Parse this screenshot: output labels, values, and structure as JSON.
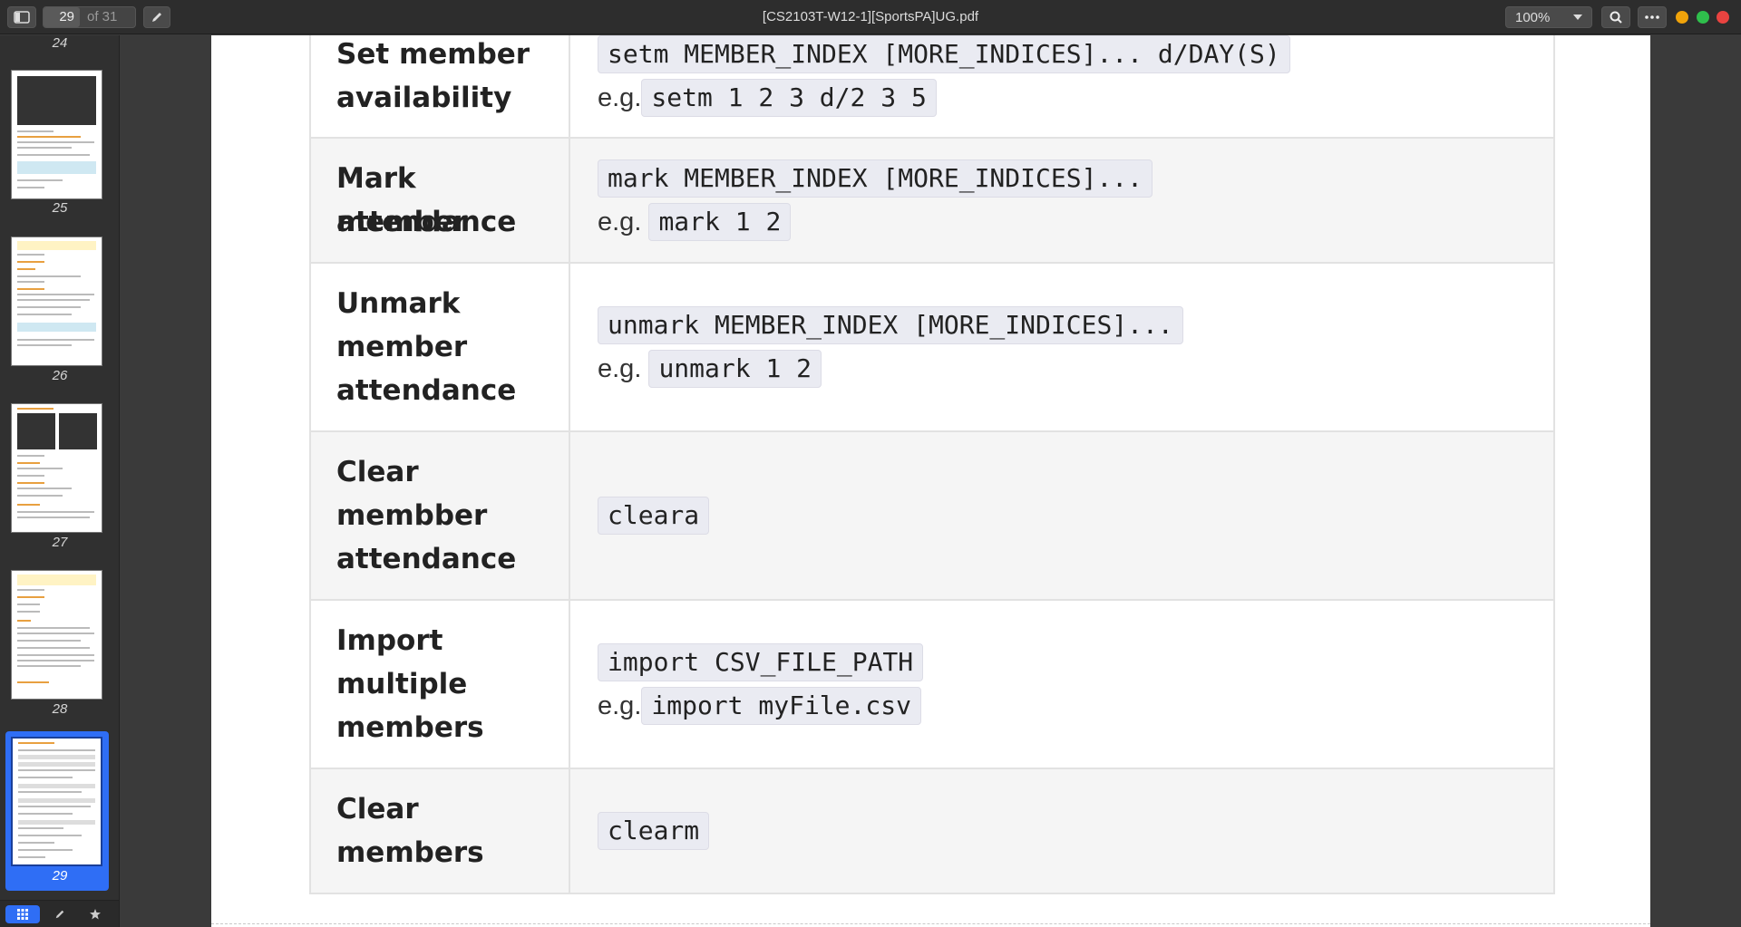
{
  "titlebar": {
    "title": "[CS2103T-W12-1][SportsPA]UG.pdf",
    "page_current": "29",
    "page_total": "of 31",
    "zoom": "100%"
  },
  "sidebar": {
    "top_label": "24",
    "thumbnails": [
      {
        "label": "25"
      },
      {
        "label": "26"
      },
      {
        "label": "27"
      },
      {
        "label": "28"
      },
      {
        "label": "29",
        "selected": true
      }
    ]
  },
  "table": {
    "rows": [
      {
        "action": [
          "Set member",
          "availability"
        ],
        "format": "setm MEMBER_INDEX [MORE_INDICES]... d/DAY(S)",
        "eg_prefix": "e.g.",
        "example": "setm 1 2 3 d/2 3 5"
      },
      {
        "action": [
          "Mark member",
          "attendance"
        ],
        "format": "mark MEMBER_INDEX [MORE_INDICES]...",
        "eg_prefix": "e.g.",
        "example": "mark 1 2"
      },
      {
        "action": [
          "Unmark",
          "member",
          "attendance"
        ],
        "format": "unmark MEMBER_INDEX [MORE_INDICES]...",
        "eg_prefix": "e.g.",
        "example": "unmark 1 2"
      },
      {
        "action": [
          "Clear",
          "membber",
          "attendance"
        ],
        "format": "cleara"
      },
      {
        "action": [
          "Import",
          "multiple",
          "members"
        ],
        "format": "import CSV_FILE_PATH",
        "eg_prefix": "e.g.",
        "example": "import myFile.csv"
      },
      {
        "action": [
          "Clear",
          "members"
        ],
        "format": "clearm"
      }
    ]
  },
  "icons": {
    "sidebar_toggle": "sidebar-toggle-icon",
    "annotate": "pencil-icon",
    "zoom_dropdown": "chevron-down-icon",
    "search": "search-icon",
    "more": "more-icon",
    "grid": "grid-icon",
    "annotations": "pencil-icon",
    "bookmarks": "star-icon"
  },
  "colors": {
    "selection": "#2f6ef5",
    "traffic_min": "#f0a30a",
    "traffic_max": "#2fbf4c",
    "traffic_close": "#e94340"
  }
}
